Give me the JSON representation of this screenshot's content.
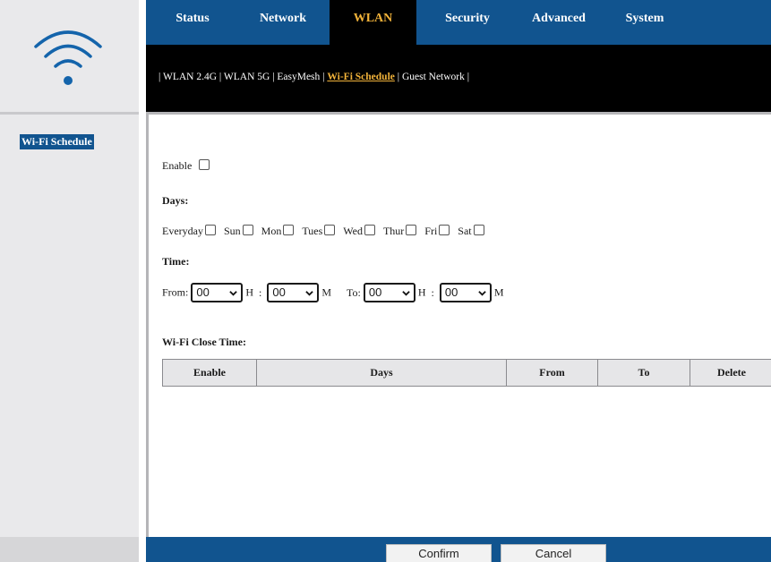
{
  "logo": {
    "icon": "wifi-icon",
    "color": "#1464ab"
  },
  "topnav": {
    "tabs": [
      {
        "label": "Status"
      },
      {
        "label": "Network"
      },
      {
        "label": "WLAN"
      },
      {
        "label": "Security"
      },
      {
        "label": "Advanced"
      },
      {
        "label": "System"
      }
    ],
    "active": "WLAN"
  },
  "subnav": {
    "sep": "|",
    "items": [
      {
        "label": "WLAN 2.4G"
      },
      {
        "label": "WLAN 5G"
      },
      {
        "label": "EasyMesh"
      },
      {
        "label": "Wi-Fi Schedule"
      },
      {
        "label": "Guest Network"
      }
    ],
    "active": "Wi-Fi Schedule"
  },
  "sidebar": {
    "items": [
      {
        "label": "Wi-Fi Schedule"
      }
    ]
  },
  "form": {
    "enable_label": "Enable",
    "days_label": "Days:",
    "days": [
      "Everyday",
      "Sun",
      "Mon",
      "Tues",
      "Wed",
      "Thur",
      "Fri",
      "Sat"
    ],
    "time_label": "Time:",
    "from_label": "From:",
    "to_label": "To:",
    "h_unit": "H",
    "colon": ":",
    "m_unit": "M",
    "from_hour": "00",
    "from_minute": "00",
    "to_hour": "00",
    "to_minute": "00",
    "close_time_label": "Wi-Fi Close Time:"
  },
  "table": {
    "headers": [
      "Enable",
      "Days",
      "From",
      "To",
      "Delete"
    ]
  },
  "footer": {
    "confirm_label": "Confirm",
    "cancel_label": "Cancel"
  },
  "colors": {
    "nav_blue": "#11548f",
    "active_text": "#f2b33a",
    "subnav_bg": "#000000",
    "sidebar_bg": "#e9e9eb"
  }
}
